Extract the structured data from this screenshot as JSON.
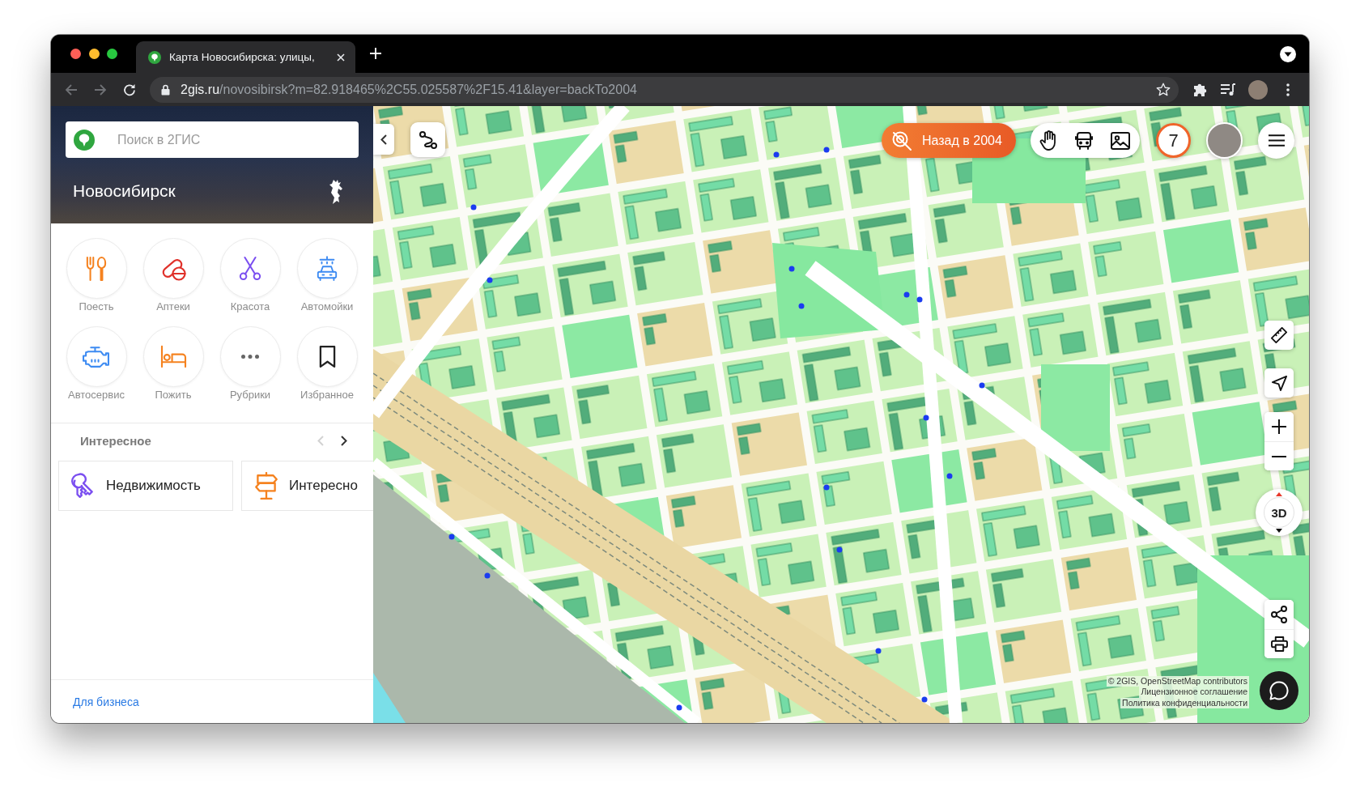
{
  "browser": {
    "tabs": [
      {
        "title": "Карта Новосибирска: улицы,",
        "selected": true
      }
    ],
    "nav_buttons": [
      {
        "kind": "back",
        "disabled": true
      },
      {
        "kind": "forward",
        "disabled": true
      },
      {
        "kind": "reload",
        "disabled": false
      }
    ],
    "address": {
      "host": "2gis.ru",
      "path": "/novosibirsk?m=82.918465%2C55.025587%2F15.41&layer=backTo2004"
    }
  },
  "sidebar": {
    "search": {
      "placeholder": "Поиск в 2ГИС"
    },
    "city": "Новосибирск",
    "categories": [
      {
        "label": "Поесть",
        "kind": "food"
      },
      {
        "label": "Аптеки",
        "kind": "pharmacy"
      },
      {
        "label": "Красота",
        "kind": "beauty"
      },
      {
        "label": "Автомойки",
        "kind": "car-wash"
      },
      {
        "label": "Автосервис",
        "kind": "car-service"
      },
      {
        "label": "Пожить",
        "kind": "lodging"
      },
      {
        "label": "Рубрики",
        "kind": "more"
      },
      {
        "label": "Избранное",
        "kind": "favorites"
      }
    ],
    "featured": {
      "title": "Интересное",
      "arrows": [
        {
          "kind": "prev",
          "disabled": true
        },
        {
          "kind": "next",
          "disabled": false
        }
      ],
      "cards": [
        {
          "label": "Недвижимость",
          "kind": "real-estate"
        },
        {
          "label": "Интересно",
          "kind": "signpost"
        }
      ]
    },
    "footer_link": "Для бизнеса"
  },
  "map": {
    "history_button": "Назад в 2004",
    "layers": [
      {
        "kind": "hand"
      },
      {
        "kind": "bus"
      },
      {
        "kind": "image"
      }
    ],
    "notification_count": "7",
    "view_mode": "3D",
    "attribution": [
      "© 2GIS, OpenStreetMap contributors",
      "Лицензионное соглашение",
      "Политика конфиденциальности"
    ]
  }
}
